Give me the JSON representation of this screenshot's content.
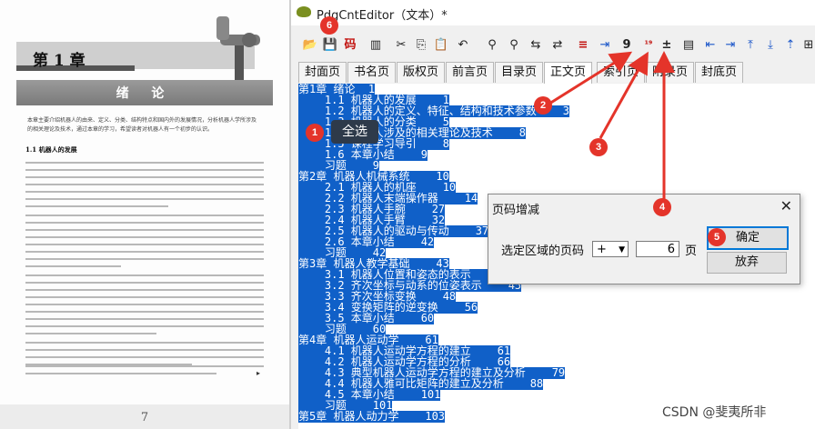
{
  "book": {
    "chapter_no": "第 1 章",
    "chapter_title": "绪  论",
    "intro_text": "本章主要介绍机器人的由来、定义、分类、结构特点和国内外的发展情况，分析机器人学所涉及的相关理论及技术，通过本章的学习，希望读者对机器人有一个初步的认识。",
    "section": "1.1  机器人的发展",
    "page_number": "7"
  },
  "window": {
    "title": "PdgCntEditor（文本）*"
  },
  "toolbar": {
    "buttons": [
      {
        "name": "open-icon",
        "glyph": "📂"
      },
      {
        "name": "save-icon",
        "glyph": "💾"
      },
      {
        "name": "encoding-button",
        "glyph": "码"
      },
      {
        "name": "bookmark-icon",
        "glyph": "▥"
      },
      {
        "name": "cut-icon",
        "glyph": "✂"
      },
      {
        "name": "copy-icon",
        "glyph": "⎘"
      },
      {
        "name": "paste-icon",
        "glyph": "📋"
      },
      {
        "name": "undo-icon",
        "glyph": "↶"
      },
      {
        "name": "find-icon",
        "glyph": "⚲"
      },
      {
        "name": "find-next-icon",
        "glyph": "⚲"
      },
      {
        "name": "replace-icon",
        "glyph": "⇆"
      },
      {
        "name": "replace-all-icon",
        "glyph": "⇄"
      },
      {
        "name": "align-left-icon",
        "glyph": "≡"
      },
      {
        "name": "indent-icon",
        "glyph": "⇥"
      },
      {
        "name": "page-number-icon",
        "glyph": "9"
      },
      {
        "name": "renumber-icon",
        "glyph": "¹⁹"
      },
      {
        "name": "page-plus-minus-icon",
        "glyph": "±"
      },
      {
        "name": "page-view-icon",
        "glyph": "▤"
      },
      {
        "name": "outdent-icon",
        "glyph": "⇤"
      },
      {
        "name": "indent-right-icon",
        "glyph": "⇥"
      },
      {
        "name": "move-top-icon",
        "glyph": "⤒"
      },
      {
        "name": "move-bottom-icon",
        "glyph": "⤓"
      },
      {
        "name": "move-up-icon",
        "glyph": "⇡"
      },
      {
        "name": "tree-icon",
        "glyph": "⊞"
      }
    ]
  },
  "tabs": [
    "封面页",
    "书名页",
    "版权页",
    "前言页",
    "目录页",
    "正文页",
    "索引页",
    "附录页",
    "封底页"
  ],
  "active_tab": "正文页",
  "toc_lines": [
    "第1章 绪论  1",
    "    1.1 机器人的发展    1",
    "    1.2 机器人的定义、特征、结构和技术参数    3",
    "    1.3 机器人的分类    5",
    "    1.4 机器人涉及的相关理论及技术    8",
    "    1.5 课程学习导引    8",
    "    1.6 本章小结    9",
    "    习题    9",
    "第2章 机器人机械系统    10",
    "    2.1 机器人的机座    10",
    "    2.2 机器人末端操作器    14",
    "    2.3 机器人手腕    27",
    "    2.4 机器人手臂    32",
    "    2.5 机器人的驱动与传动    37",
    "    2.6 本章小结    42",
    "    习题    42",
    "第3章 机器人教学基础    43",
    "    3.1 机器人位置和姿态的表示    43",
    "    3.2 齐次坐标与动系的位姿表示    45",
    "    3.3 齐次坐标变换    48",
    "    3.4 变换矩阵的逆变换    56",
    "    3.5 本章小结    60",
    "    习题    60",
    "第4章 机器人运动学    61",
    "    4.1 机器人运动学方程的建立    61",
    "    4.2 机器人运动学方程的分析    66",
    "    4.3 典型机器人运动学方程的建立及分析    79",
    "    4.4 机器人雅可比矩阵的建立及分析    88",
    "    4.5 本章小结    101",
    "    习题    101",
    "第5章 机器人动力学    103"
  ],
  "context_popup": "全选",
  "dialog": {
    "title": "页码增减",
    "close_glyph": "✕",
    "label": "选定区域的页码",
    "operator": "+",
    "value": "6",
    "unit": "页",
    "ok": "确定",
    "cancel": "放弃"
  },
  "badges": [
    "1",
    "2",
    "3",
    "4",
    "5",
    "6"
  ],
  "watermark": "CSDN @斐夷所非",
  "colors": {
    "selection": "#1060c8",
    "badge": "#e4342a",
    "arrow": "#e4342a"
  }
}
